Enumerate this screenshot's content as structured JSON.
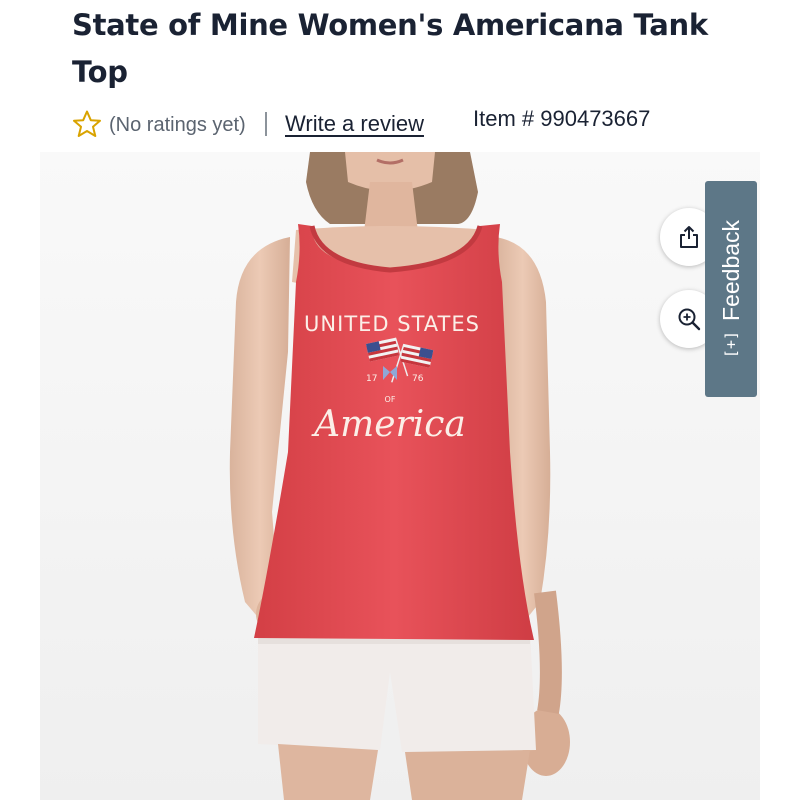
{
  "product": {
    "title": "State of Mine Women's Americana Tank Top",
    "ratings_text": "(No ratings yet)",
    "write_review": "Write a review",
    "item_number": "Item # 990473667"
  },
  "image": {
    "shirt_line1": "UNITED STATES",
    "year_left": "17",
    "year_right": "76",
    "of": "OF",
    "america": "America"
  },
  "actions": {
    "share_icon": "share-icon",
    "zoom_icon": "zoom-in-icon"
  },
  "feedback": {
    "icon_text": "[+]",
    "label": "Feedback"
  },
  "colors": {
    "star": "#d9a300",
    "shirt": "#e3484e",
    "feedback_tab": "#5d7787"
  }
}
